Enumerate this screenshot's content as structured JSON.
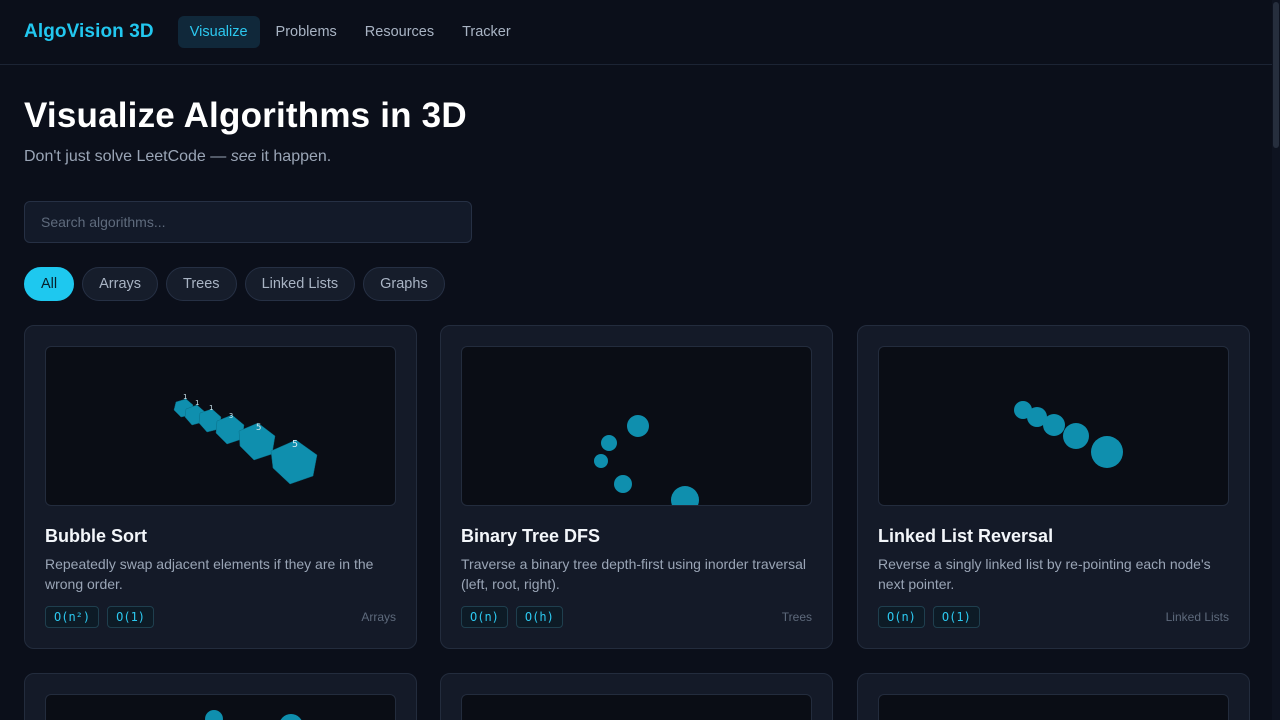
{
  "app": {
    "brand": "AlgoVision 3D"
  },
  "nav": {
    "items": [
      {
        "label": "Visualize",
        "active": true
      },
      {
        "label": "Problems",
        "active": false
      },
      {
        "label": "Resources",
        "active": false
      },
      {
        "label": "Tracker",
        "active": false
      }
    ]
  },
  "hero": {
    "title": "Visualize Algorithms in 3D",
    "subtitle_prefix": "Don't just solve LeetCode — ",
    "subtitle_emphasis": "see",
    "subtitle_suffix": " it happen."
  },
  "search": {
    "placeholder": "Search algorithms...",
    "value": ""
  },
  "filters": {
    "items": [
      {
        "label": "All",
        "active": true
      },
      {
        "label": "Arrays",
        "active": false
      },
      {
        "label": "Trees",
        "active": false
      },
      {
        "label": "Linked Lists",
        "active": false
      },
      {
        "label": "Graphs",
        "active": false
      }
    ]
  },
  "cards": [
    {
      "title": "Bubble Sort",
      "description": "Repeatedly swap adjacent elements if they are in the wrong order.",
      "time": "O(n²)",
      "space": "O(1)",
      "category": "Arrays",
      "viz_labels": [
        "1",
        "1",
        "1",
        "3",
        "5",
        "5"
      ]
    },
    {
      "title": "Binary Tree DFS",
      "description": "Traverse a binary tree depth-first using inorder traversal (left, root, right).",
      "time": "O(n)",
      "space": "O(h)",
      "category": "Trees"
    },
    {
      "title": "Linked List Reversal",
      "description": "Reverse a singly linked list by re-pointing each node's next pointer.",
      "time": "O(n)",
      "space": "O(1)",
      "category": "Linked Lists"
    }
  ],
  "colors": {
    "accent": "#22c7ef",
    "background": "#0b0f1a",
    "card": "#141a28",
    "viz_shape": "#0f8fae"
  }
}
